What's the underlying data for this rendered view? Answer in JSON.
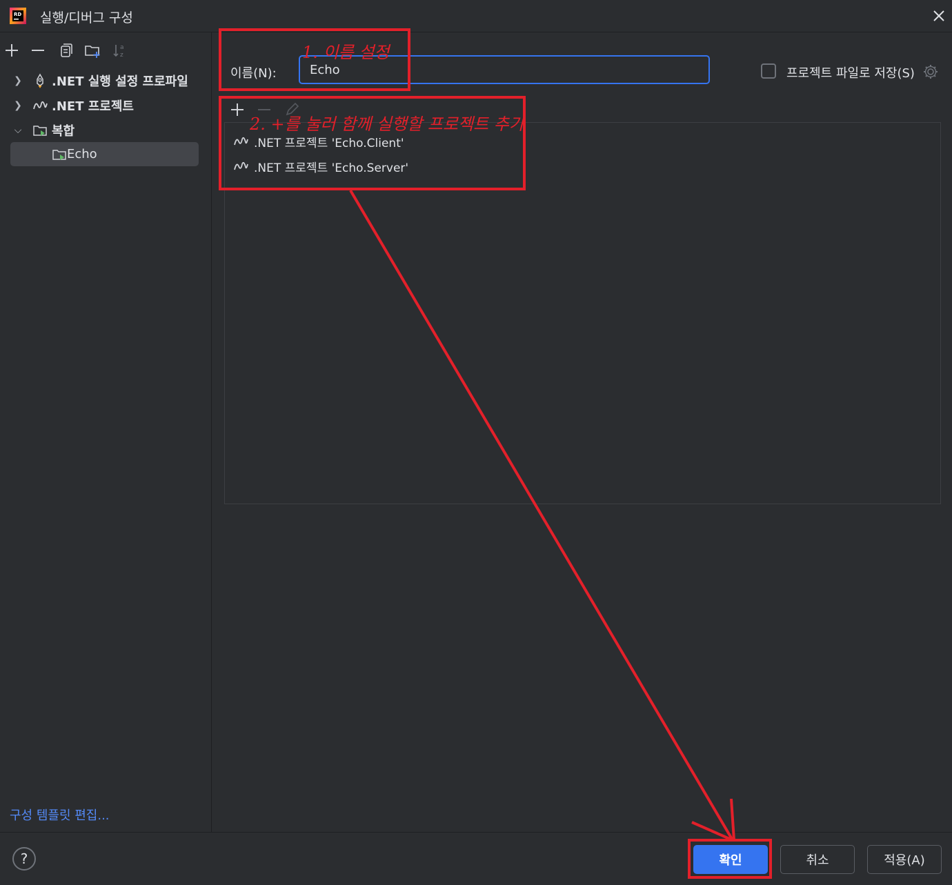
{
  "window": {
    "title": "실행/디버그 구성",
    "app_logo_text": "RD"
  },
  "left_panel": {
    "toolbar": [
      "add-icon",
      "remove-icon",
      "copy-icon",
      "new-folder-icon",
      "sort-icon"
    ],
    "tree": [
      {
        "label": ".NET 실행 설정 프로파일",
        "expanded": false,
        "icon": "launch-settings-icon"
      },
      {
        "label": ".NET 프로젝트",
        "expanded": false,
        "icon": "dotnet-icon"
      },
      {
        "label": "복합",
        "expanded": true,
        "icon": "compound-folder-icon"
      },
      {
        "label": "Echo",
        "selected": true,
        "icon": "compound-run-icon"
      }
    ],
    "edit_templates_link": "구성 템플릿 편집..."
  },
  "form": {
    "name_label": "이름(N):",
    "name_value": "Echo",
    "store_as_project_file_label": "프로젝트 파일로 저장(S)",
    "store_as_project_file_checked": false
  },
  "project_list": {
    "toolbar": [
      "add-icon",
      "remove-icon",
      "edit-icon"
    ],
    "items": [
      ".NET 프로젝트 'Echo.Client'",
      ".NET 프로젝트 'Echo.Server'"
    ]
  },
  "buttons": {
    "ok": "확인",
    "cancel": "취소",
    "apply": "적용(A)",
    "help": "?"
  },
  "annotations": {
    "step1": "1. 이름 설정",
    "step2": "2. +를 눌러 함께 실행할 프로젝트 추가",
    "color": "#e3202a"
  },
  "colors": {
    "background": "#2b2d30",
    "accent": "#3574f0",
    "link": "#548af7",
    "selection": "#43454a"
  }
}
